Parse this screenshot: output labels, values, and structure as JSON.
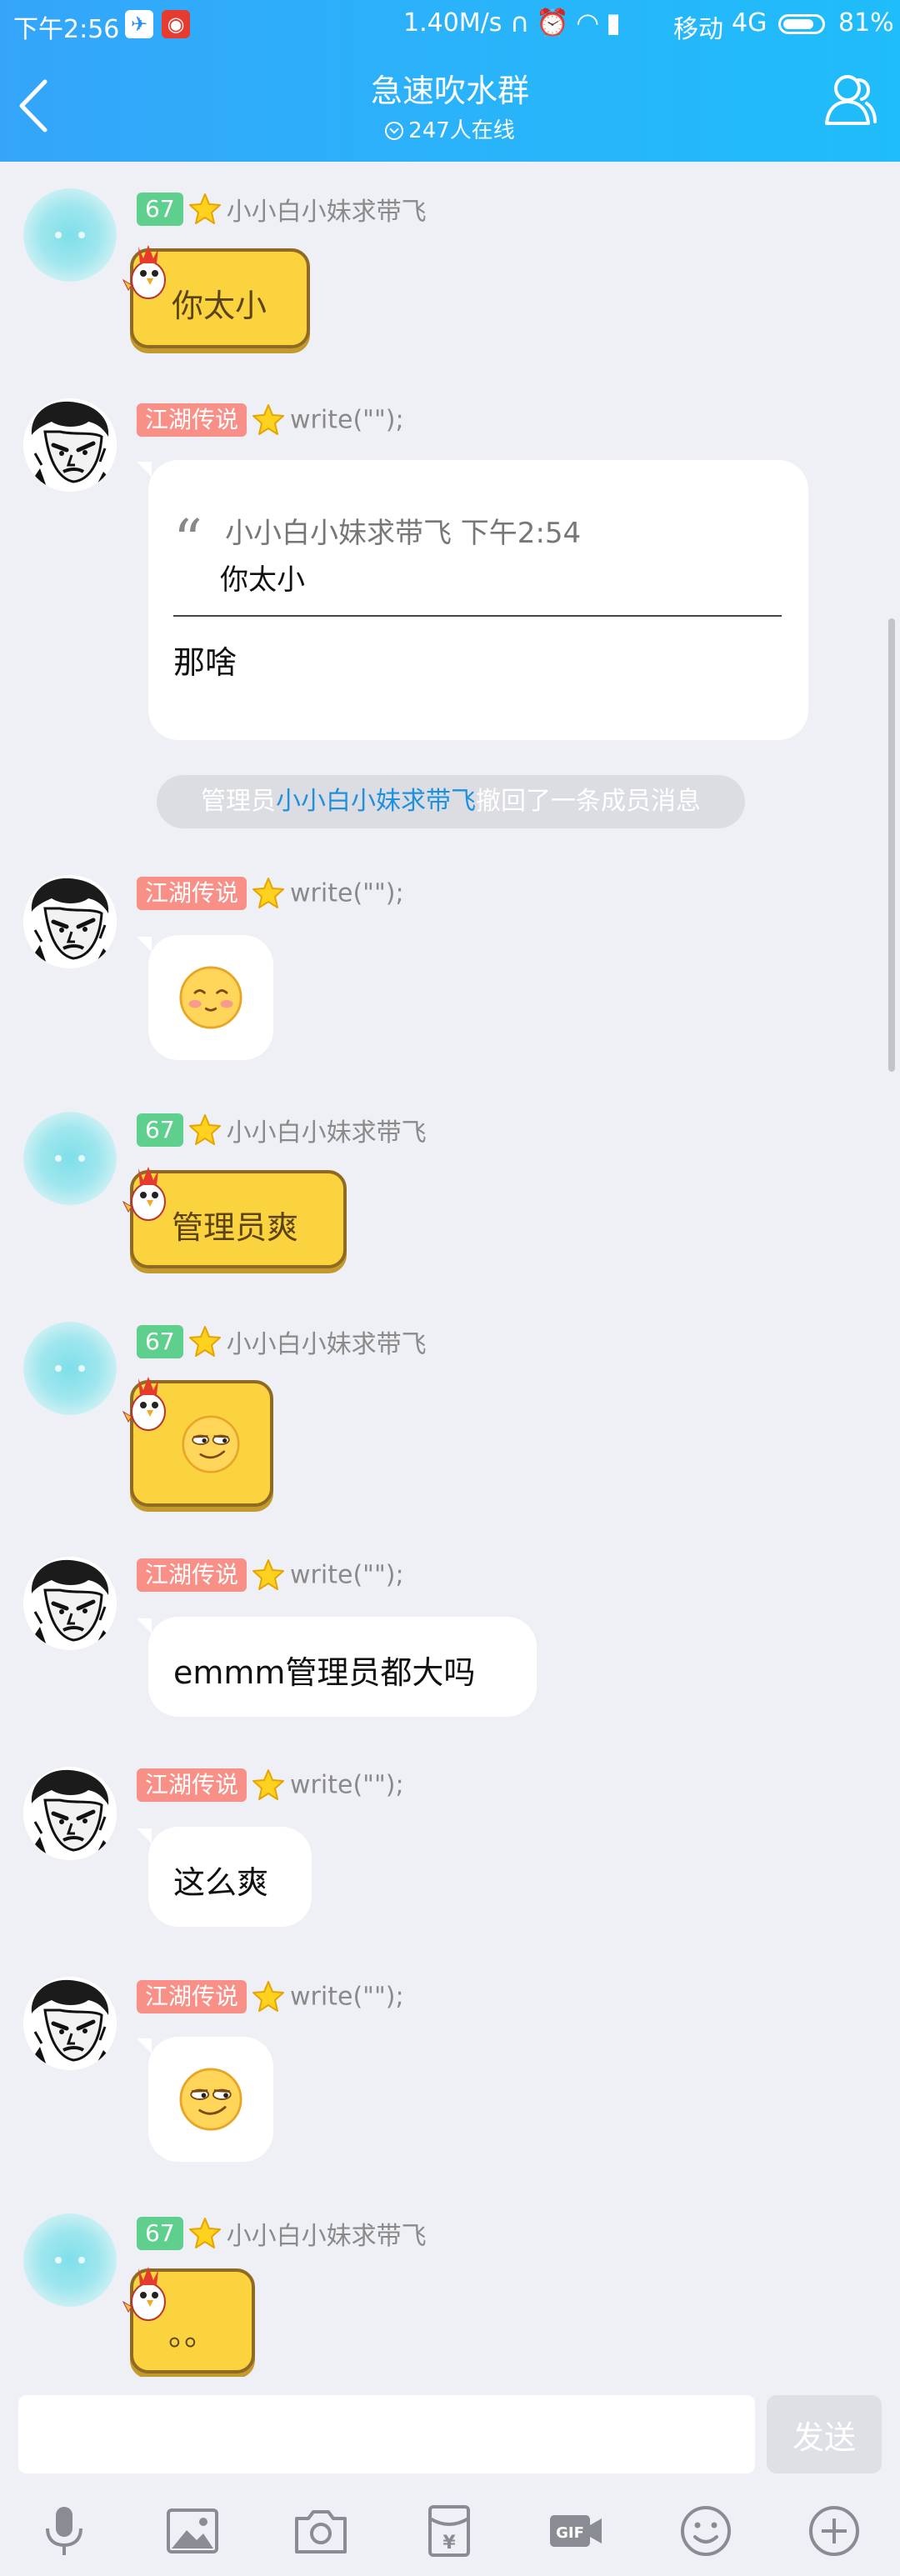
{
  "status_bar": {
    "time": "下午2:56",
    "speed": "1.40M/s",
    "carrier": "移动",
    "network": "4G",
    "battery": "81%",
    "battery_level": 0.81
  },
  "header": {
    "title": "急速吹水群",
    "online": "247人在线"
  },
  "messages": {
    "m1": {
      "level": "67",
      "nick": "小小白小妹求带飞",
      "text": "你太小"
    },
    "m2": {
      "title": "江湖传说",
      "nick": "write(\"\");",
      "quote_author_time": "小小白小妹求带飞 下午2:54",
      "quote_text": "你太小",
      "reply": "那啥"
    },
    "notice": {
      "prefix": "管理员",
      "name": "小小白小妹求带飞",
      "suffix": "撤回了一条成员消息"
    },
    "m3": {
      "title": "江湖传说",
      "nick": "write(\"\");",
      "emoji": "blush-emoji"
    },
    "m4": {
      "level": "67",
      "nick": "小小白小妹求带飞",
      "text": "管理员爽"
    },
    "m5": {
      "level": "67",
      "nick": "小小白小妹求带飞",
      "emoji": "smirk-emoji"
    },
    "m6": {
      "title": "江湖传说",
      "nick": "write(\"\");",
      "text": "emmm管理员都大吗"
    },
    "m7": {
      "title": "江湖传说",
      "nick": "write(\"\");",
      "text": "这么爽"
    },
    "m8": {
      "title": "江湖传说",
      "nick": "write(\"\");",
      "emoji": "smirk-emoji"
    },
    "m9": {
      "level": "67",
      "nick": "小小白小妹求带飞",
      "text": "。。"
    }
  },
  "input": {
    "value": "",
    "send_label": "发送"
  },
  "toolbar": {
    "icons": [
      "voice-icon",
      "image-icon",
      "camera-icon",
      "red-packet-icon",
      "gif-icon",
      "emoji-icon",
      "plus-icon"
    ]
  },
  "colors": {
    "header_gradient_start": "#35a5fa",
    "header_gradient_end": "#1fbdf9",
    "bubble_yellow": "#fbd33f",
    "level_badge": "#5fcf8e",
    "title_badge": "#f89088",
    "link": "#1e90e0"
  }
}
